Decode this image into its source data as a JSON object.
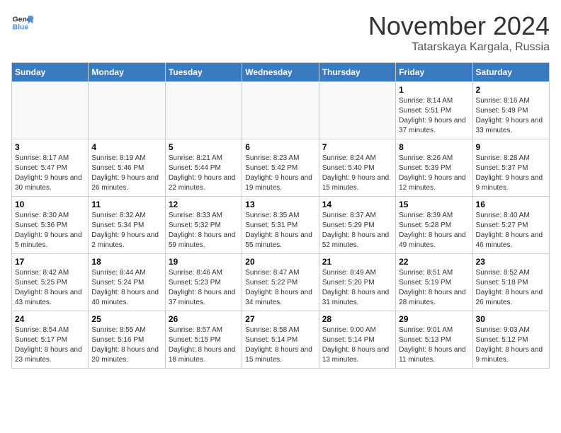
{
  "logo": {
    "text_general": "General",
    "text_blue": "Blue"
  },
  "title": "November 2024",
  "location": "Tatarskaya Kargala, Russia",
  "days_of_week": [
    "Sunday",
    "Monday",
    "Tuesday",
    "Wednesday",
    "Thursday",
    "Friday",
    "Saturday"
  ],
  "weeks": [
    [
      {
        "day": "",
        "empty": true
      },
      {
        "day": "",
        "empty": true
      },
      {
        "day": "",
        "empty": true
      },
      {
        "day": "",
        "empty": true
      },
      {
        "day": "",
        "empty": true
      },
      {
        "day": "1",
        "sunrise": "8:14 AM",
        "sunset": "5:51 PM",
        "daylight": "9 hours and 37 minutes."
      },
      {
        "day": "2",
        "sunrise": "8:16 AM",
        "sunset": "5:49 PM",
        "daylight": "9 hours and 33 minutes."
      }
    ],
    [
      {
        "day": "3",
        "sunrise": "8:17 AM",
        "sunset": "5:47 PM",
        "daylight": "9 hours and 30 minutes."
      },
      {
        "day": "4",
        "sunrise": "8:19 AM",
        "sunset": "5:46 PM",
        "daylight": "9 hours and 26 minutes."
      },
      {
        "day": "5",
        "sunrise": "8:21 AM",
        "sunset": "5:44 PM",
        "daylight": "9 hours and 22 minutes."
      },
      {
        "day": "6",
        "sunrise": "8:23 AM",
        "sunset": "5:42 PM",
        "daylight": "9 hours and 19 minutes."
      },
      {
        "day": "7",
        "sunrise": "8:24 AM",
        "sunset": "5:40 PM",
        "daylight": "9 hours and 15 minutes."
      },
      {
        "day": "8",
        "sunrise": "8:26 AM",
        "sunset": "5:39 PM",
        "daylight": "9 hours and 12 minutes."
      },
      {
        "day": "9",
        "sunrise": "8:28 AM",
        "sunset": "5:37 PM",
        "daylight": "9 hours and 9 minutes."
      }
    ],
    [
      {
        "day": "10",
        "sunrise": "8:30 AM",
        "sunset": "5:36 PM",
        "daylight": "9 hours and 5 minutes."
      },
      {
        "day": "11",
        "sunrise": "8:32 AM",
        "sunset": "5:34 PM",
        "daylight": "9 hours and 2 minutes."
      },
      {
        "day": "12",
        "sunrise": "8:33 AM",
        "sunset": "5:32 PM",
        "daylight": "8 hours and 59 minutes."
      },
      {
        "day": "13",
        "sunrise": "8:35 AM",
        "sunset": "5:31 PM",
        "daylight": "8 hours and 55 minutes."
      },
      {
        "day": "14",
        "sunrise": "8:37 AM",
        "sunset": "5:29 PM",
        "daylight": "8 hours and 52 minutes."
      },
      {
        "day": "15",
        "sunrise": "8:39 AM",
        "sunset": "5:28 PM",
        "daylight": "8 hours and 49 minutes."
      },
      {
        "day": "16",
        "sunrise": "8:40 AM",
        "sunset": "5:27 PM",
        "daylight": "8 hours and 46 minutes."
      }
    ],
    [
      {
        "day": "17",
        "sunrise": "8:42 AM",
        "sunset": "5:25 PM",
        "daylight": "8 hours and 43 minutes."
      },
      {
        "day": "18",
        "sunrise": "8:44 AM",
        "sunset": "5:24 PM",
        "daylight": "8 hours and 40 minutes."
      },
      {
        "day": "19",
        "sunrise": "8:46 AM",
        "sunset": "5:23 PM",
        "daylight": "8 hours and 37 minutes."
      },
      {
        "day": "20",
        "sunrise": "8:47 AM",
        "sunset": "5:22 PM",
        "daylight": "8 hours and 34 minutes."
      },
      {
        "day": "21",
        "sunrise": "8:49 AM",
        "sunset": "5:20 PM",
        "daylight": "8 hours and 31 minutes."
      },
      {
        "day": "22",
        "sunrise": "8:51 AM",
        "sunset": "5:19 PM",
        "daylight": "8 hours and 28 minutes."
      },
      {
        "day": "23",
        "sunrise": "8:52 AM",
        "sunset": "5:18 PM",
        "daylight": "8 hours and 26 minutes."
      }
    ],
    [
      {
        "day": "24",
        "sunrise": "8:54 AM",
        "sunset": "5:17 PM",
        "daylight": "8 hours and 23 minutes."
      },
      {
        "day": "25",
        "sunrise": "8:55 AM",
        "sunset": "5:16 PM",
        "daylight": "8 hours and 20 minutes."
      },
      {
        "day": "26",
        "sunrise": "8:57 AM",
        "sunset": "5:15 PM",
        "daylight": "8 hours and 18 minutes."
      },
      {
        "day": "27",
        "sunrise": "8:58 AM",
        "sunset": "5:14 PM",
        "daylight": "8 hours and 15 minutes."
      },
      {
        "day": "28",
        "sunrise": "9:00 AM",
        "sunset": "5:14 PM",
        "daylight": "8 hours and 13 minutes."
      },
      {
        "day": "29",
        "sunrise": "9:01 AM",
        "sunset": "5:13 PM",
        "daylight": "8 hours and 11 minutes."
      },
      {
        "day": "30",
        "sunrise": "9:03 AM",
        "sunset": "5:12 PM",
        "daylight": "8 hours and 9 minutes."
      }
    ]
  ]
}
